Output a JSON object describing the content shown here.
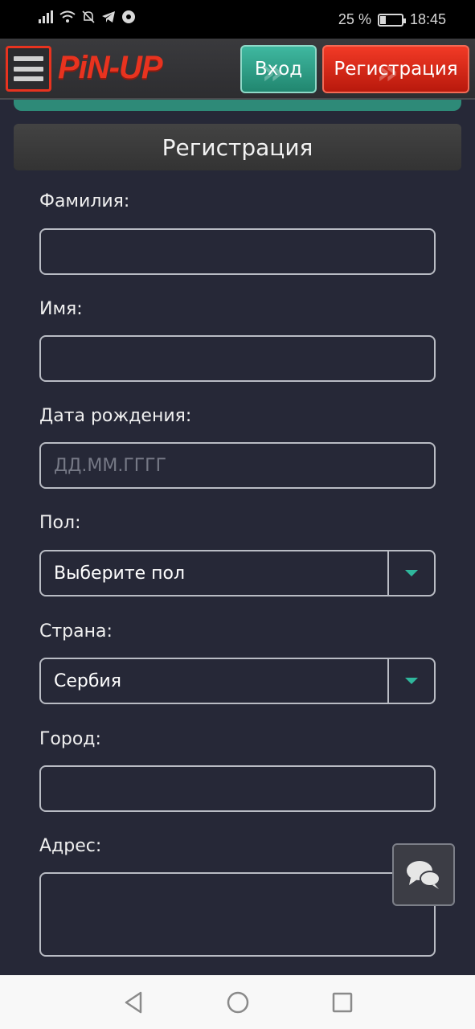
{
  "status_bar": {
    "battery_text": "25 %",
    "battery_level": 0.25,
    "time": "18:45",
    "icons": [
      "signal-icon",
      "wifi-icon",
      "bell-off-icon",
      "telegram-icon",
      "settings-badge-icon",
      "battery-icon"
    ]
  },
  "header": {
    "logo_text": "PiN-UP",
    "login_label": "Вход",
    "register_label": "Регистрация",
    "colors": {
      "brand": "#e8331f",
      "login": "#2a9c84",
      "register": "#e12a18"
    }
  },
  "form": {
    "title": "Регистрация",
    "fields": {
      "surname": {
        "label": "Фамилия:",
        "value": ""
      },
      "name": {
        "label": "Имя:",
        "value": ""
      },
      "birthdate": {
        "label": "Дата рождения:",
        "placeholder": "ДД.ММ.ГГГГ"
      },
      "gender": {
        "label": "Пол:",
        "selected": "Выберите пол"
      },
      "country": {
        "label": "Страна:",
        "selected": "Сербия"
      },
      "city": {
        "label": "Город:",
        "value": ""
      },
      "address": {
        "label": "Адрес:",
        "value": ""
      }
    },
    "accent_color": "#2fb79c"
  },
  "chat": {
    "icon": "chat-bubbles-icon"
  },
  "nav_bar": {
    "icons": [
      "back-icon",
      "home-icon",
      "recents-icon"
    ]
  }
}
